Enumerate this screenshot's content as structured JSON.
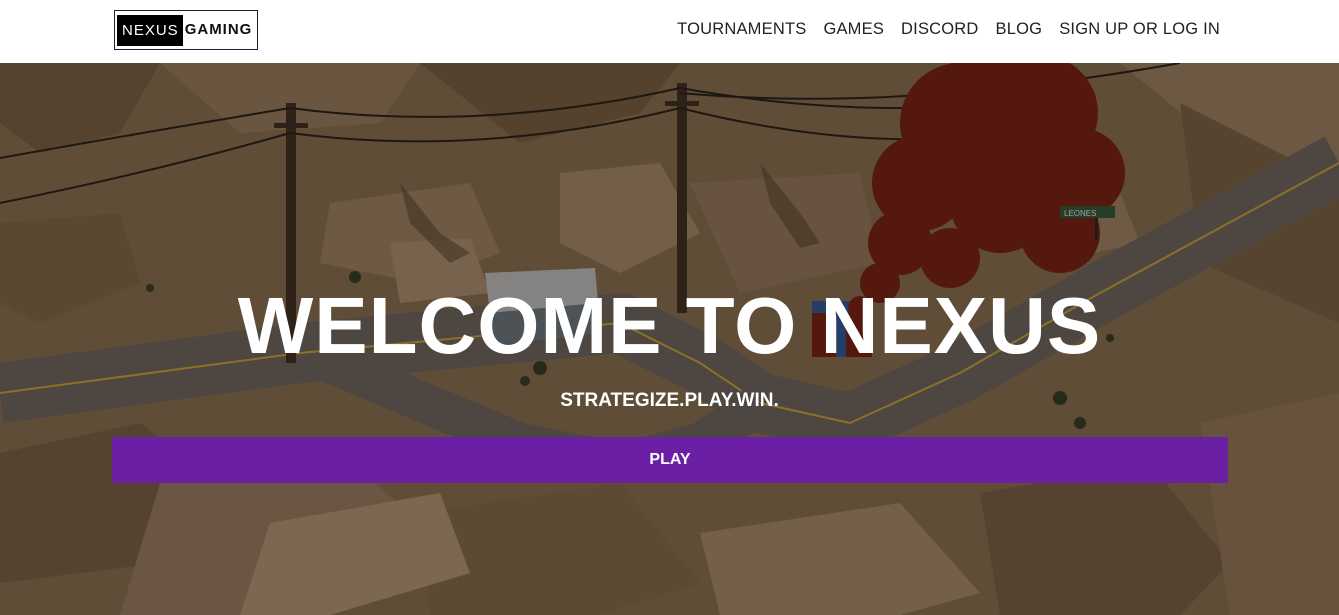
{
  "logo": {
    "part1": "NEXUS",
    "part2": "GAMING"
  },
  "nav": {
    "tournaments": "TOURNAMENTS",
    "games": "GAMES",
    "discord": "DISCORD",
    "blog": "BLOG",
    "account": "SIGN UP OR LOG IN"
  },
  "hero": {
    "title": "WELCOME TO NEXUS",
    "subtitle": "STRATEGIZE.PLAY.WIN.",
    "play_label": "PLAY",
    "sign_text": "LEONES"
  },
  "colors": {
    "accent": "#6a1fa4",
    "navbar_bg": "#ffffff",
    "terrain": "#8d7356",
    "smoke": "#7a1a10"
  }
}
